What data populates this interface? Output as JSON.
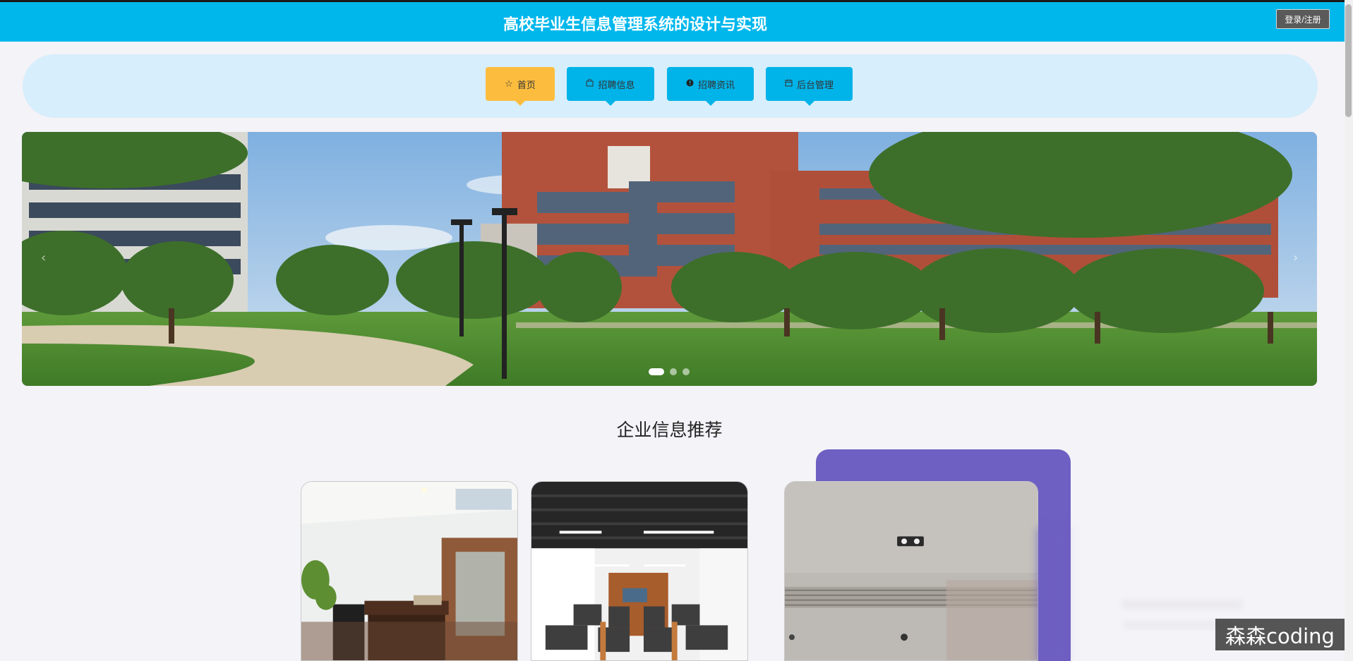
{
  "header": {
    "title": "高校毕业生信息管理系统的设计与实现",
    "login_label": "登录/注册"
  },
  "nav": {
    "items": [
      {
        "label": "首页",
        "icon": "star-outline-icon",
        "active": true
      },
      {
        "label": "招聘信息",
        "icon": "shopping-bag-icon"
      },
      {
        "label": "招聘资讯",
        "icon": "info-circle-icon"
      },
      {
        "label": "后台管理",
        "icon": "calendar-icon"
      }
    ]
  },
  "banner": {
    "slide_count": 3,
    "active_slide": 1
  },
  "section": {
    "title": "企业信息推荐"
  },
  "watermark": "森森coding",
  "colors": {
    "header_bg": "#00b7ec",
    "nav_active": "#fcbd3f",
    "nav_item": "#00b3e8",
    "nav_band": "#d7eefc",
    "accent_purple": "#6e5fc2"
  }
}
